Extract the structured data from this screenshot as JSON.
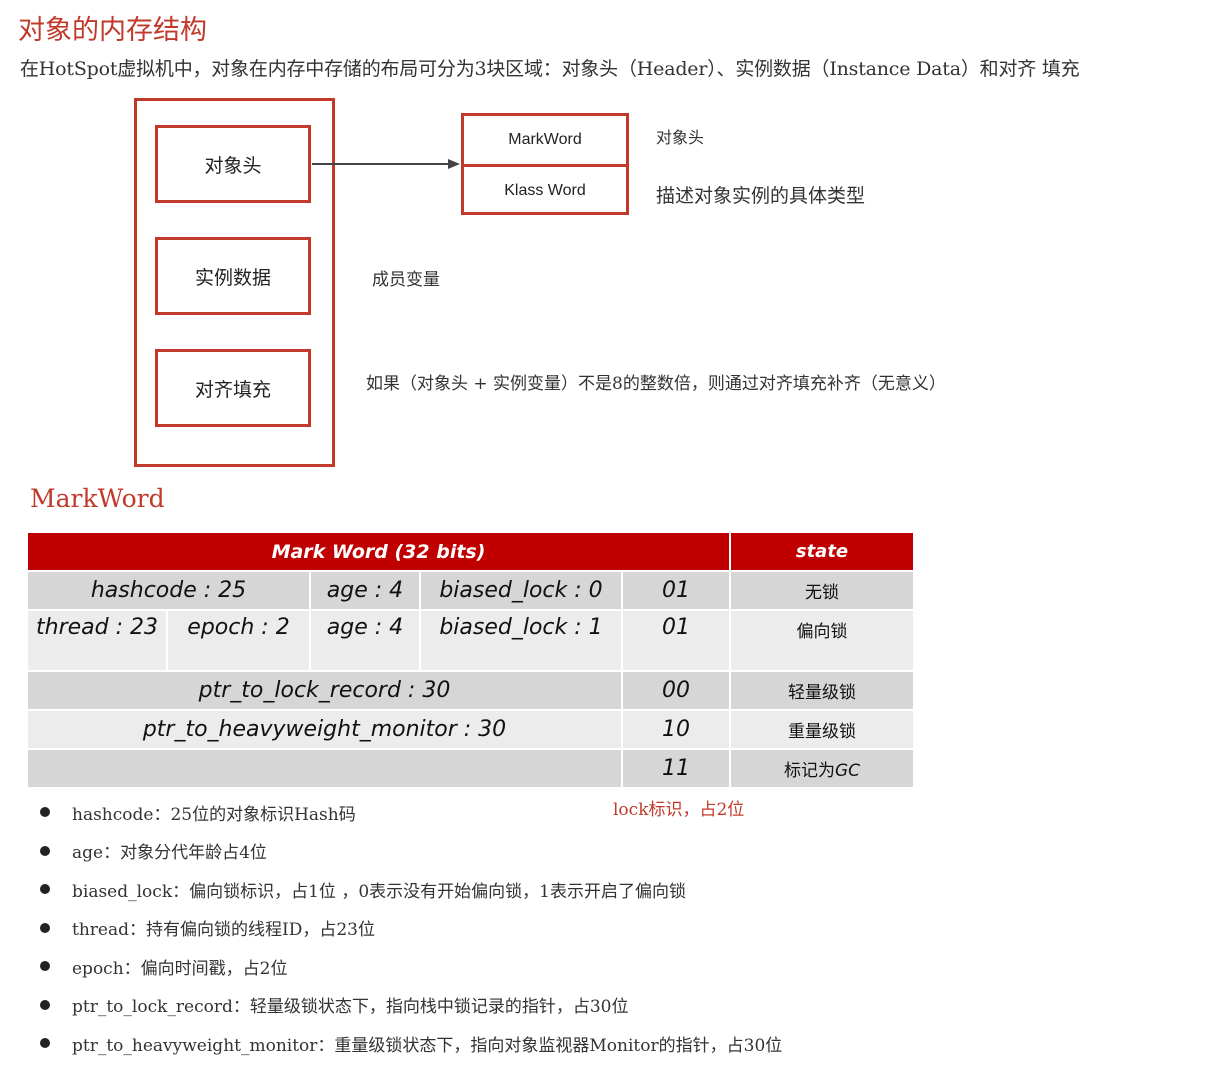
{
  "title": "对象的内存结构",
  "intro": "在HotSpot虚拟机中，对象在内存中存储的布局可分为3块区域：对象头（Header）、实例数据（Instance Data）和对齐 填充",
  "layout_boxes": {
    "header": "对象头",
    "instance_data": "实例数据",
    "padding": "对齐填充"
  },
  "header_detail": {
    "markword": "MarkWord",
    "klass_word": "Klass Word",
    "markword_note": "对象头",
    "klass_note": "描述对象实例的具体类型"
  },
  "instance_note": "成员变量",
  "padding_note": "如果（对象头 + 实例变量）不是8的整数倍，则通过对齐填充补齐（无意义）",
  "markword_section_title": "MarkWord",
  "table": {
    "head_main": "Mark Word (32 bits)",
    "head_state": "state",
    "rows": {
      "r1": {
        "hashcode": "hashcode : 25",
        "age": "age : 4",
        "biased": "biased_lock : 0",
        "bits": "01",
        "state": "无锁"
      },
      "r2": {
        "thread": "thread : 23",
        "epoch": "epoch : 2",
        "age": "age : 4",
        "biased": "biased_lock : 1",
        "bits": "01",
        "state": "偏向锁"
      },
      "r3": {
        "ptr": "ptr_to_lock_record : 30",
        "bits": "00",
        "state": "轻量级锁"
      },
      "r4": {
        "ptr": "ptr_to_heavyweight_monitor : 30",
        "bits": "10",
        "state": "重量级锁"
      },
      "r5": {
        "bits": "11",
        "state_prefix": "标记为",
        "state_suffix": "GC"
      }
    }
  },
  "lock_note": "lock标识，占2位",
  "bullets": [
    "hashcode：25位的对象标识Hash码",
    "age：对象分代年龄占4位",
    "biased_lock：偏向锁标识，占1位 ，0表示没有开始偏向锁，1表示开启了偏向锁",
    "thread：持有偏向锁的线程ID，占23位",
    "epoch：偏向时间戳，占2位",
    "ptr_to_lock_record：轻量级锁状态下，指向栈中锁记录的指针，占30位",
    "ptr_to_heavyweight_monitor：重量级锁状态下，指向对象监视器Monitor的指针，占30位"
  ],
  "colors": {
    "accent": "#c0392b",
    "table_head": "#c00000",
    "row_dark": "#d6d6d6",
    "row_light": "#ececec"
  }
}
